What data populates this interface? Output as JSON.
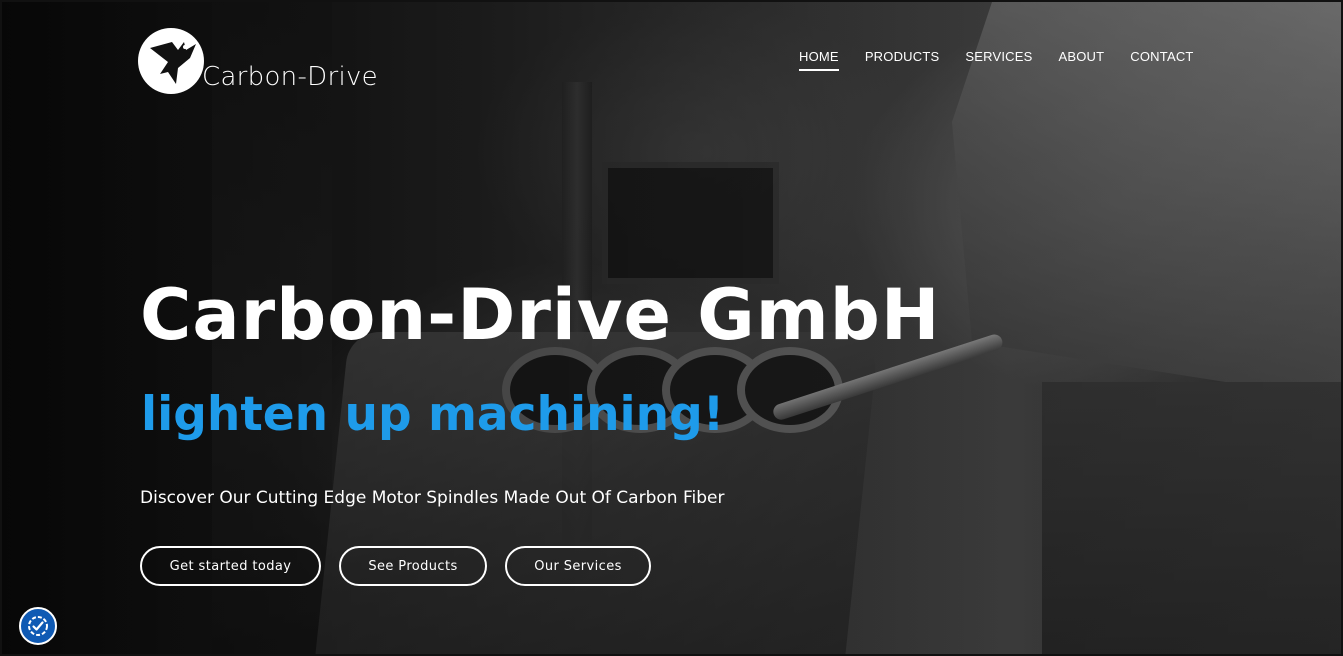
{
  "brand": {
    "name": "Carbon-Drive",
    "logo_icon": "hummingbird-logo-icon"
  },
  "nav": {
    "items": [
      {
        "label": "HOME",
        "active": true
      },
      {
        "label": "PRODUCTS",
        "active": false
      },
      {
        "label": "SERVICES",
        "active": false
      },
      {
        "label": "ABOUT",
        "active": false
      },
      {
        "label": "CONTACT",
        "active": false
      }
    ]
  },
  "hero": {
    "title": "Carbon-Drive GmbH",
    "tagline": "lighten up machining!",
    "subtitle": "Discover Our Cutting Edge Motor Spindles Made Out Of Carbon Fiber",
    "buttons": [
      {
        "label": "Get started today"
      },
      {
        "label": "See Products"
      },
      {
        "label": "Our Services"
      }
    ]
  },
  "accessibility_widget": {
    "icon": "accessibility-icon"
  },
  "colors": {
    "accent": "#1e9bea",
    "accessibility_button": "#0f5ab4"
  }
}
